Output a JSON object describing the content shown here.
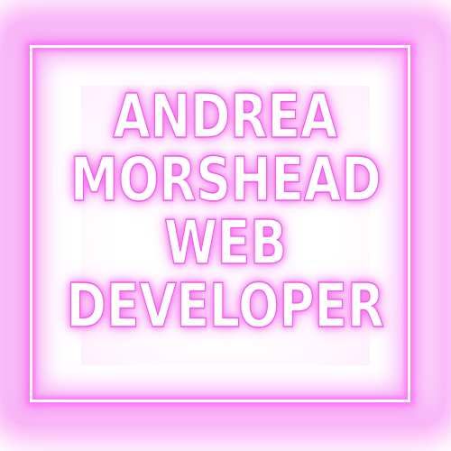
{
  "sign": {
    "lines": [
      "ANDREA",
      "MORSHEAD",
      "WEB",
      "DEVELOPER"
    ]
  },
  "colors": {
    "background": "#ffffff",
    "neon_pink": "#f05ce8",
    "frame_tube": "#ffffff"
  }
}
